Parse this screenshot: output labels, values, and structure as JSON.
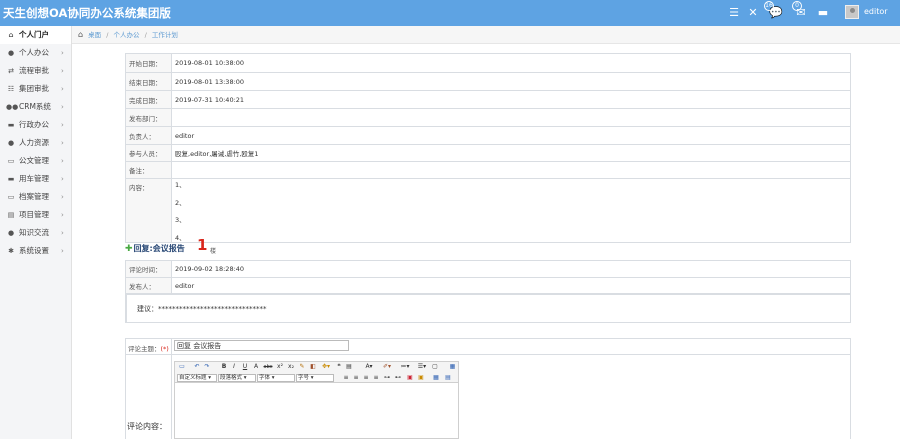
{
  "header": {
    "title": "天生创想OA协同办公系统集团版",
    "badges": {
      "messages": "16",
      "notifications": "0"
    },
    "username": "editor",
    "accent": "#5ea3e3"
  },
  "sidebar": {
    "items": [
      {
        "label": "个人门户",
        "icon": "home-icon",
        "active": true
      },
      {
        "label": "个人办公",
        "icon": "user-icon"
      },
      {
        "label": "流程审批",
        "icon": "retweet-icon"
      },
      {
        "label": "集团审批",
        "icon": "list-icon"
      },
      {
        "label": "CRM系统",
        "icon": "users-icon"
      },
      {
        "label": "行政办公",
        "icon": "comment-icon"
      },
      {
        "label": "人力资源",
        "icon": "person-icon"
      },
      {
        "label": "公文管理",
        "icon": "folder-icon"
      },
      {
        "label": "用车管理",
        "icon": "truck-icon"
      },
      {
        "label": "档案管理",
        "icon": "archive-icon"
      },
      {
        "label": "项目管理",
        "icon": "project-icon"
      },
      {
        "label": "知识交流",
        "icon": "chat-icon"
      },
      {
        "label": "系统设置",
        "icon": "cogs-icon"
      }
    ]
  },
  "breadcrumb": [
    "桌面",
    "个人办公",
    "工作计划"
  ],
  "plan": {
    "start_label": "开始日期：",
    "start_value": "2019-08-01 10:38:00",
    "end_label": "结束日期：",
    "end_value": "2019-08-01 13:38:00",
    "done_label": "完成日期：",
    "done_value": "2019-07-31 10:40:21",
    "dept_label": "发布部门：",
    "dept_value": "",
    "owner_label": "负责人：",
    "owner_value": "editor",
    "participants_label": "参与人员：",
    "participants_value": "殴复,editor,屠诫,虐竹,殴复1",
    "remark_label": "备注：",
    "remark_value": "",
    "content_label": "内容：",
    "content_lines": [
      "1、",
      "2、",
      "3、",
      "4、"
    ]
  },
  "reply": {
    "title": "回复:会议报告",
    "floor": "1",
    "floor_unit": "楼",
    "time_label": "评论时间：",
    "time_value": "2019-09-02 18:28:40",
    "author_label": "发布人：",
    "author_value": "editor",
    "suggestion": "建议：*******************************"
  },
  "form": {
    "subject_label": "评论主题：",
    "required_mark": "(*)",
    "subject_value": "回复 会议报告",
    "content_label": "评论内容：",
    "toolbar": {
      "custom_title": "自定义标题",
      "paragraph": "段落格式",
      "font": "字体",
      "size": "字号"
    }
  }
}
